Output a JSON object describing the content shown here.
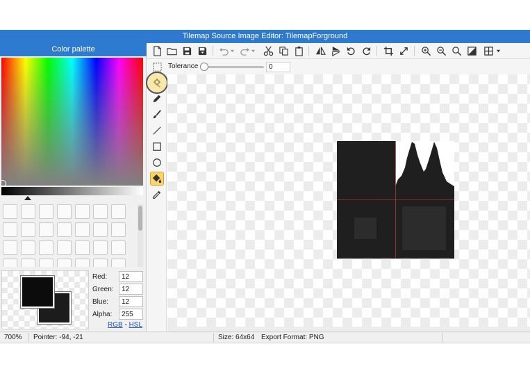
{
  "window": {
    "title": "Tilemap Source Image Editor: TilemapForground"
  },
  "palette": {
    "title": "Color palette",
    "swatch_count": 28,
    "foreground_color": "#0c0c0c",
    "background_color": "#1c1c1c"
  },
  "color_fields": [
    {
      "label": "Red:",
      "value": "12"
    },
    {
      "label": "Green:",
      "value": "12"
    },
    {
      "label": "Blue:",
      "value": "12"
    },
    {
      "label": "Alpha:",
      "value": "255"
    }
  ],
  "color_mode": {
    "rgb": "RGB",
    "separator": " - ",
    "hsl": "HSL"
  },
  "toolbar": {
    "icons": [
      "new-file-icon",
      "open-folder-icon",
      "save-icon",
      "save-as-icon",
      "undo-icon",
      "redo-icon",
      "cut-icon",
      "copy-icon",
      "paste-icon",
      "flip-horizontal-icon",
      "flip-vertical-icon",
      "rotate-left-icon",
      "rotate-right-icon",
      "crop-icon",
      "resize-icon",
      "zoom-in-icon",
      "zoom-out-icon",
      "zoom-fit-icon",
      "invert-icon",
      "grid-icon"
    ]
  },
  "options": {
    "tolerance_label": "Tolerance",
    "tolerance_value": "0",
    "tolerance_level": 0
  },
  "tools": {
    "items": [
      "magic-wand-icon",
      "pencil-icon",
      "brush-icon",
      "line-icon",
      "rectangle-icon",
      "ellipse-icon",
      "fill-bucket-icon",
      "eyedropper-icon"
    ],
    "active": "fill-bucket-icon",
    "highlighted": "magic-wand-icon"
  },
  "canvas": {
    "tile_color": "#1f1f1f",
    "inner_square_color": "#2c2c2c",
    "grid_line_color": "#b5322a"
  },
  "status": {
    "zoom": "700%",
    "pointer": "Pointer: -94, -21",
    "size": "Size: 64x64",
    "export_format": "Export Format: PNG"
  },
  "colors": {
    "accent": "#2e7ad1",
    "active_tool": "#fbd36a"
  }
}
